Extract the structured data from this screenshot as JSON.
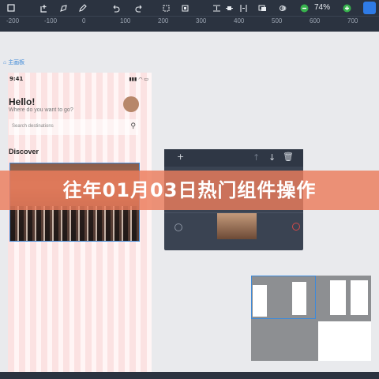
{
  "toolbar": {
    "zoom_label": "74%",
    "icons": [
      "pointer-icon",
      "add-icon",
      "pen-icon",
      "pencil-icon",
      "undo-icon",
      "redo-icon",
      "crop-icon",
      "resize-icon",
      "align-icon",
      "align-center-icon",
      "align-distribute-icon",
      "arrange-icon",
      "mask-icon",
      "zoom-out-icon",
      "zoom-in-icon",
      "help-icon"
    ]
  },
  "ruler": {
    "ticks": [
      "-200",
      "-100",
      "0",
      "100",
      "200",
      "300",
      "400",
      "500",
      "600",
      "700"
    ]
  },
  "artboard": {
    "label": "主画板"
  },
  "phone": {
    "time": "9:41",
    "greeting": "Hello!",
    "subtitle": "Where do you want to go?",
    "search_placeholder": "Search destinations",
    "section_title": "Discover"
  },
  "banner": {
    "title": "往年01月03日热门组件操作"
  },
  "colors": {
    "toolbar_bg": "#2b3340",
    "accent": "#3f8ad8",
    "banner": "#eb7c5c",
    "panel_bg": "#3a4352"
  }
}
